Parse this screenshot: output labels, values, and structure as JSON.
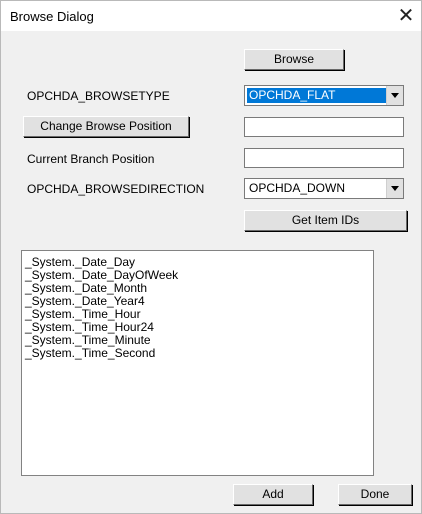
{
  "window": {
    "title": "Browse Dialog",
    "close_glyph": "✕"
  },
  "browse_button": "Browse",
  "browsetype": {
    "label": "OPCHDA_BROWSETYPE",
    "value": "OPCHDA_FLAT"
  },
  "change_position_button": "Change Browse Position",
  "change_position_value": "",
  "current_branch": {
    "label": "Current Branch Position",
    "value": ""
  },
  "browsedirection": {
    "label": "OPCHDA_BROWSEDIRECTION",
    "value": "OPCHDA_DOWN"
  },
  "get_item_ids_button": "Get Item IDs",
  "items": [
    "_System._Date_Day",
    "_System._Date_DayOfWeek",
    "_System._Date_Month",
    "_System._Date_Year4",
    "_System._Time_Hour",
    "_System._Time_Hour24",
    "_System._Time_Minute",
    "_System._Time_Second"
  ],
  "add_button": "Add",
  "done_button": "Done",
  "icons": {
    "dropdown": "chevron-down-icon",
    "close": "close-icon"
  }
}
